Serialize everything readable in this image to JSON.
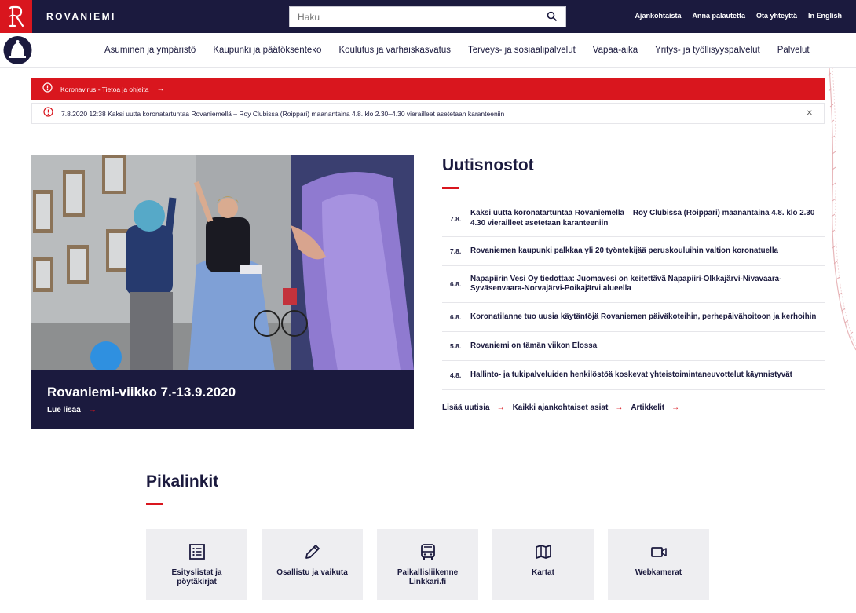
{
  "header": {
    "brand": "ROVANIEMI",
    "search_placeholder": "Haku",
    "top_links": [
      "Ajankohtaista",
      "Anna palautetta",
      "Ota yhteyttä",
      "In English"
    ]
  },
  "nav": {
    "items": [
      "Asuminen ja ympäristö",
      "Kaupunki ja päätöksenteko",
      "Koulutus ja varhaiskasvatus",
      "Terveys- ja sosiaalipalvelut",
      "Vapaa-aika",
      "Yritys- ja työllisyyspalvelut",
      "Palvelut"
    ]
  },
  "alerts": {
    "primary": "Koronavirus - Tietoa ja ohjeita",
    "secondary": "7.8.2020 12:38 Kaksi uutta koronatartuntaa Rovaniemellä – Roy Clubissa (Roippari) maanantaina 4.8. klo 2.30–4.30 vierailleet asetetaan karanteeniin"
  },
  "hero": {
    "title": "Rovaniemi-viikko 7.-13.9.2020",
    "link": "Lue lisää"
  },
  "news": {
    "heading": "Uutisnostot",
    "items": [
      {
        "date": "7.8.",
        "title": "Kaksi uutta koronatartuntaa Rovaniemellä – Roy Clubissa (Roippari) maanantaina 4.8. klo 2.30–4.30 vierailleet asetetaan karanteeniin"
      },
      {
        "date": "7.8.",
        "title": "Rovaniemen kaupunki palkkaa yli 20 työntekijää peruskouluihin valtion koronatuella"
      },
      {
        "date": "6.8.",
        "title": "Napapiirin Vesi Oy tiedottaa: Juomavesi on keitettävä Napapiiri-Olkkajärvi-Nivavaara-Syväsenvaara-Norvajärvi-Poikajärvi alueella"
      },
      {
        "date": "6.8.",
        "title": "Koronatilanne tuo uusia käytäntöjä Rovaniemen päiväkoteihin, perhepäivähoitoon ja kerhoihin"
      },
      {
        "date": "5.8.",
        "title": "Rovaniemi on tämän viikon Elossa"
      },
      {
        "date": "4.8.",
        "title": "Hallinto- ja tukipalveluiden henkilöstöä koskevat yhteistoimintaneuvottelut käynnistyvät"
      }
    ],
    "links": [
      "Lisää uutisia",
      "Kaikki ajankohtaiset asiat",
      "Artikkelit"
    ]
  },
  "quicklinks": {
    "heading": "Pikalinkit",
    "tiles": [
      {
        "label": "Esityslistat ja pöytäkirjat",
        "icon": "list-icon"
      },
      {
        "label": "Osallistu ja vaikuta",
        "icon": "pencil-icon"
      },
      {
        "label": "Paikallisliikenne Linkkari.fi",
        "icon": "bus-icon"
      },
      {
        "label": "Kartat",
        "icon": "map-icon"
      },
      {
        "label": "Webkamerat",
        "icon": "video-camera-icon"
      }
    ]
  },
  "colors": {
    "navy": "#1b1a3e",
    "red": "#d9161e",
    "tile_bg": "#eeeef1"
  }
}
